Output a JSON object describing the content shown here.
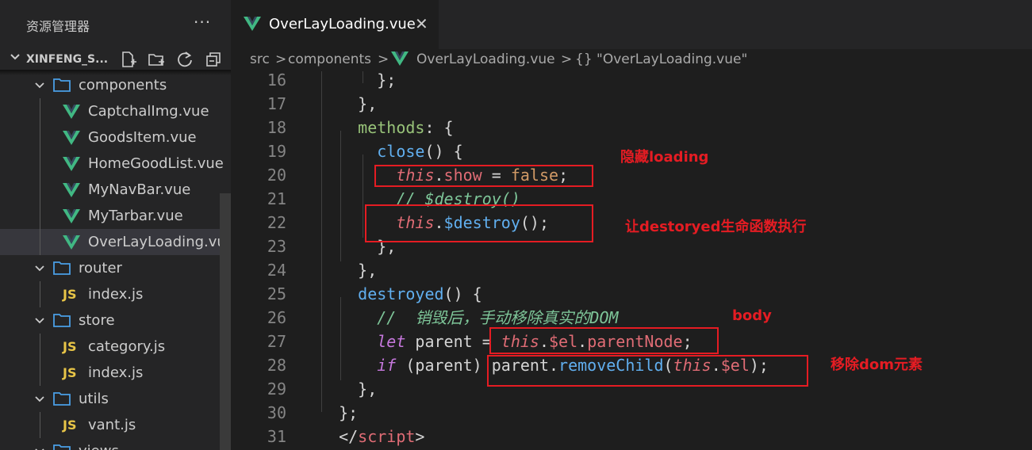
{
  "sidebar": {
    "title": "资源管理器",
    "more_label": "···",
    "project_name": "XINFENG_S...",
    "tree": [
      {
        "type": "folder",
        "label": "components"
      },
      {
        "type": "vue",
        "label": "CaptchalImg.vue"
      },
      {
        "type": "vue",
        "label": "GoodsItem.vue"
      },
      {
        "type": "vue",
        "label": "HomeGoodList.vue"
      },
      {
        "type": "vue",
        "label": "MyNavBar.vue"
      },
      {
        "type": "vue",
        "label": "MyTarbar.vue"
      },
      {
        "type": "vue",
        "label": "OverLayLoading.vue",
        "selected": true
      },
      {
        "type": "folder",
        "label": "router"
      },
      {
        "type": "js",
        "label": "index.js"
      },
      {
        "type": "folder",
        "label": "store"
      },
      {
        "type": "js",
        "label": "category.js"
      },
      {
        "type": "js",
        "label": "index.js"
      },
      {
        "type": "folder",
        "label": "utils"
      },
      {
        "type": "js",
        "label": "vant.js"
      },
      {
        "type": "folder",
        "label": "views"
      }
    ],
    "js_badge": "JS"
  },
  "editor": {
    "tab": {
      "label": "OverLayLoading.vue",
      "close": "✕"
    },
    "breadcrumb": {
      "items": [
        "src",
        "components",
        "OverLayLoading.vue",
        "{} \"OverLayLoading.vue\""
      ],
      "separator": ">"
    },
    "line_numbers": [
      "16",
      "17",
      "18",
      "19",
      "20",
      "21",
      "22",
      "23",
      "24",
      "25",
      "26",
      "27",
      "28",
      "29",
      "30",
      "31"
    ]
  },
  "annotations": {
    "hide_loading": "隐藏loading",
    "destroyed_exec": "让destoryed生命函数执行",
    "body": "body",
    "remove_dom": "移除dom元素"
  },
  "colors": {
    "annotation_red": "#e51c23",
    "vue_green": "#41b883",
    "js_yellow": "#e8c547",
    "folder_blue": "#4a9fe6"
  }
}
